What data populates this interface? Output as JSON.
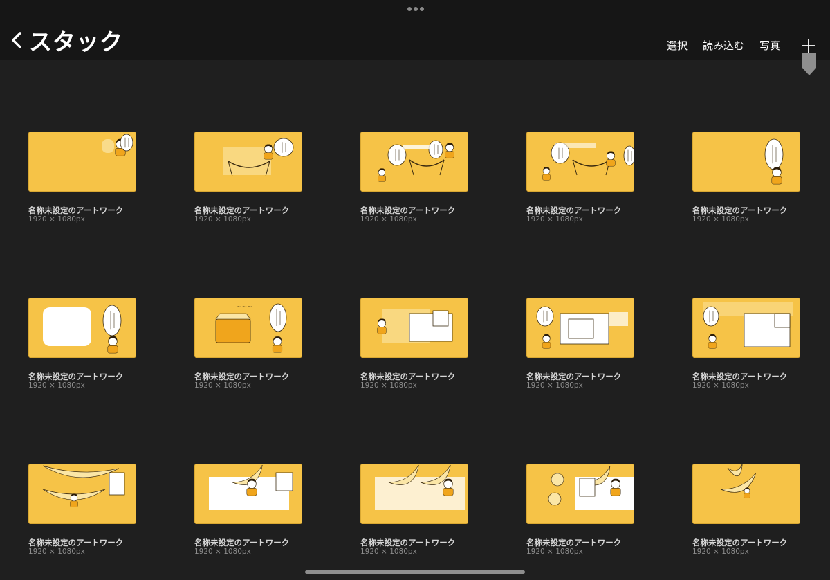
{
  "header": {
    "title": "スタック",
    "actions": [
      {
        "id": "select",
        "label": "選択"
      },
      {
        "id": "import",
        "label": "読み込む"
      },
      {
        "id": "photo",
        "label": "写真"
      }
    ]
  },
  "artworks": [
    {
      "name": "名称未設定のアートワーク",
      "size": "1920 × 1080px",
      "thumb": "a"
    },
    {
      "name": "名称未設定のアートワーク",
      "size": "1920 × 1080px",
      "thumb": "b"
    },
    {
      "name": "名称未設定のアートワーク",
      "size": "1920 × 1080px",
      "thumb": "c"
    },
    {
      "name": "名称未設定のアートワーク",
      "size": "1920 × 1080px",
      "thumb": "d"
    },
    {
      "name": "名称未設定のアートワーク",
      "size": "1920 × 1080px",
      "thumb": "e"
    },
    {
      "name": "名称未設定のアートワーク",
      "size": "1920 × 1080px",
      "thumb": "f"
    },
    {
      "name": "名称未設定のアートワーク",
      "size": "1920 × 1080px",
      "thumb": "g"
    },
    {
      "name": "名称未設定のアートワーク",
      "size": "1920 × 1080px",
      "thumb": "h"
    },
    {
      "name": "名称未設定のアートワーク",
      "size": "1920 × 1080px",
      "thumb": "i"
    },
    {
      "name": "名称未設定のアートワーク",
      "size": "1920 × 1080px",
      "thumb": "j"
    },
    {
      "name": "名称未設定のアートワーク",
      "size": "1920 × 1080px",
      "thumb": "k"
    },
    {
      "name": "名称未設定のアートワーク",
      "size": "1920 × 1080px",
      "thumb": "l"
    },
    {
      "name": "名称未設定のアートワーク",
      "size": "1920 × 1080px",
      "thumb": "m"
    },
    {
      "name": "名称未設定のアートワーク",
      "size": "1920 × 1080px",
      "thumb": "n"
    },
    {
      "name": "名称未設定のアートワーク",
      "size": "1920 × 1080px",
      "thumb": "o"
    }
  ],
  "colors": {
    "background": "#1f1f1f",
    "topbar": "#161616",
    "thumbnail": "#f6c347"
  }
}
